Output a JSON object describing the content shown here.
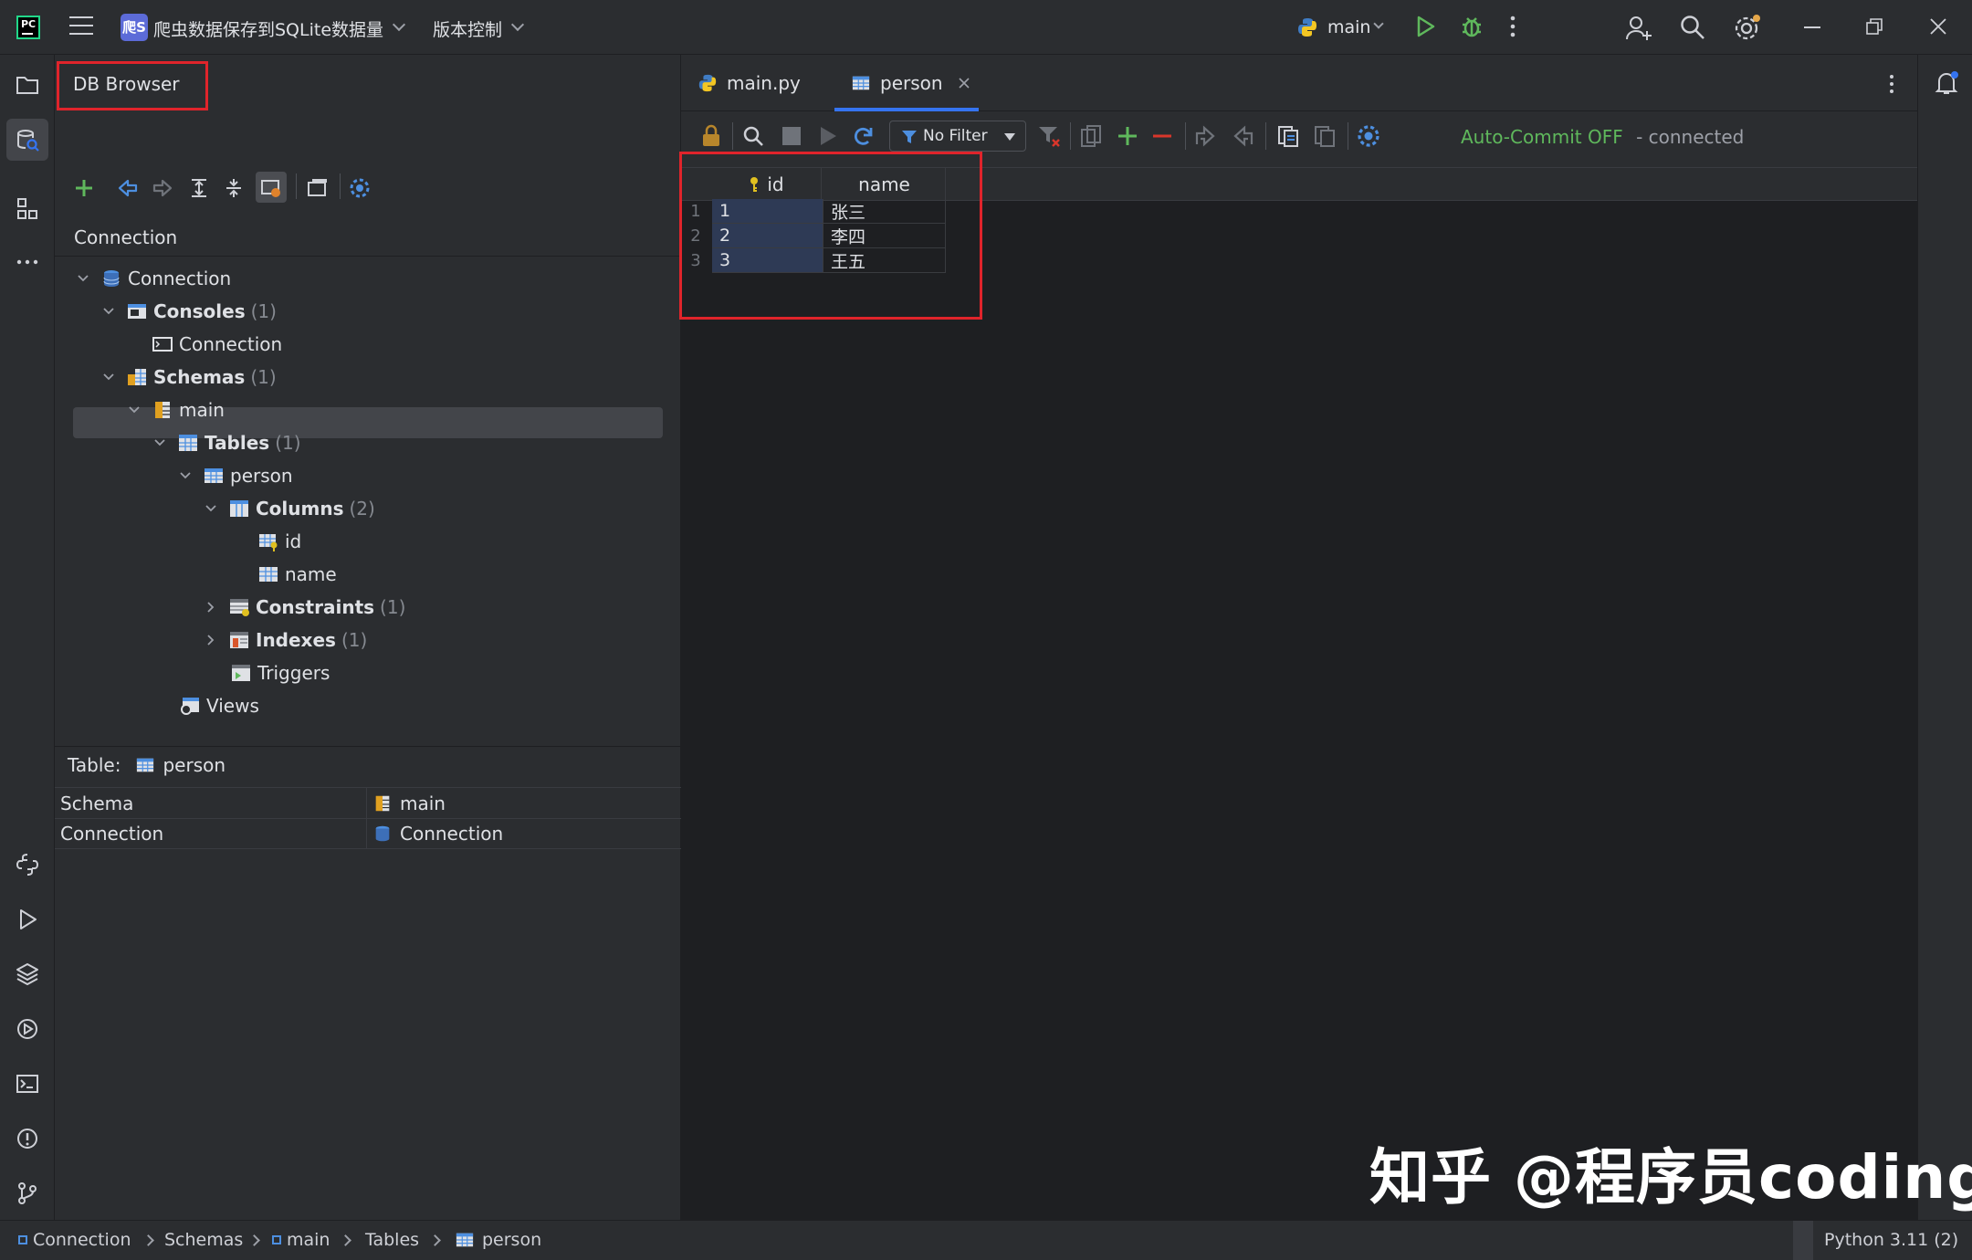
{
  "titlebar": {
    "project_badge": "爬S",
    "project_name": "爬虫数据保存到SQLite数据量",
    "vcs_label": "版本控制",
    "run_config": "main"
  },
  "db_panel": {
    "title": "DB Browser",
    "connection_label": "Connection",
    "tree": {
      "connection": "Connection",
      "consoles": "Consoles",
      "consoles_count": "(1)",
      "console_item": "Connection",
      "schemas": "Schemas",
      "schemas_count": "(1)",
      "schema_main": "main",
      "tables": "Tables",
      "tables_count": "(1)",
      "table_person": "person",
      "columns": "Columns",
      "columns_count": "(2)",
      "col_id": "id",
      "col_name": "name",
      "constraints": "Constraints",
      "constraints_count": "(1)",
      "indexes": "Indexes",
      "indexes_count": "(1)",
      "triggers": "Triggers",
      "views": "Views"
    },
    "properties": {
      "header_label": "Table:",
      "header_value": "person",
      "rows": [
        {
          "key": "Schema",
          "value": "main"
        },
        {
          "key": "Connection",
          "value": "Connection"
        }
      ]
    }
  },
  "editor": {
    "tabs": [
      {
        "label": "main.py"
      },
      {
        "label": "person",
        "active": true
      }
    ],
    "filter_label": "No Filter",
    "status": {
      "autocommit": "Auto-Commit OFF",
      "connection": "- connected"
    },
    "grid": {
      "columns": [
        "id",
        "name"
      ],
      "rows": [
        {
          "num": "1",
          "id": "1",
          "name": "张三"
        },
        {
          "num": "2",
          "id": "2",
          "name": "李四"
        },
        {
          "num": "3",
          "id": "3",
          "name": "王五"
        }
      ]
    }
  },
  "statusbar": {
    "breadcrumb": [
      "Connection",
      "Schemas",
      "main",
      "Tables",
      "person"
    ],
    "interpreter": "Python 3.11 (2)"
  },
  "watermark": "知乎 @程序员coding",
  "colors": {
    "accent": "#3574f0",
    "highlight_box": "#e0242b",
    "autocommit": "#5fb85c",
    "selection": "#43454a"
  }
}
